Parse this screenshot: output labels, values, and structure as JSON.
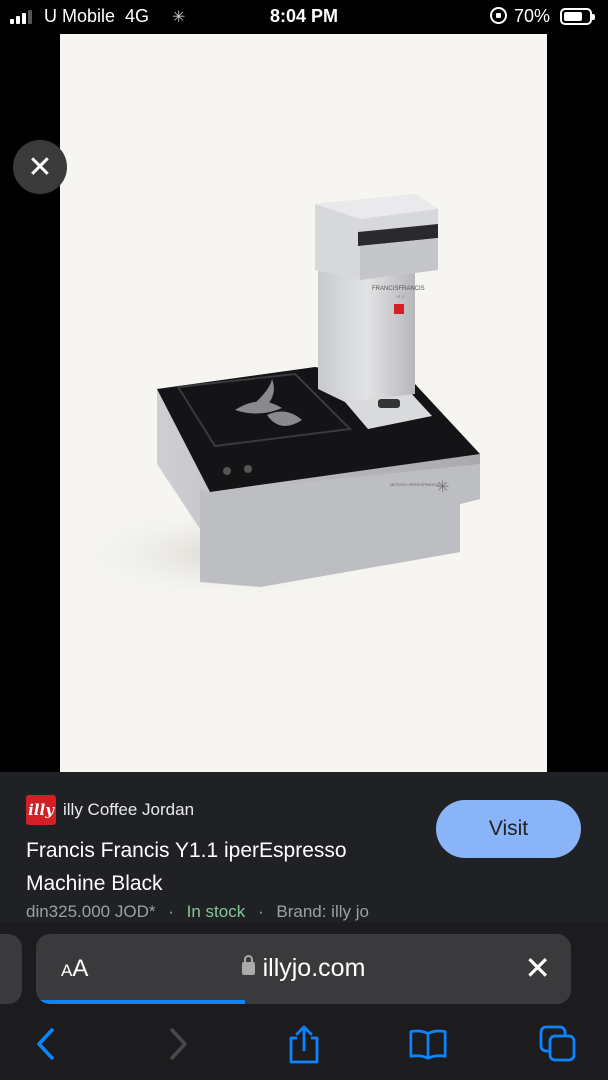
{
  "status_bar": {
    "carrier": "U Mobile",
    "network": "4G",
    "time": "8:04 PM",
    "battery_percent": "70%",
    "battery_level": 0.7
  },
  "product": {
    "site_name": "illy Coffee Jordan",
    "logo_text": "illy",
    "title": "Francis Francis Y1.1 iperEspresso Machine Black",
    "price": "din325.000 JOD*",
    "separator": "·",
    "availability": "In stock",
    "brand": "Brand: illy jo",
    "visit_label": "Visit"
  },
  "image_text": {
    "machine_brand": "FRANCISFRANCIS",
    "machine_model": "Y1.1",
    "method": "METODO IPERESPRESSO"
  },
  "browser": {
    "aa_label_small": "A",
    "aa_label_large": "A",
    "url": "illyjo.com",
    "load_progress": 0.39
  },
  "icons": {
    "close": "close-icon",
    "back": "chevron-left-icon",
    "forward": "chevron-right-icon",
    "share": "share-icon",
    "bookmarks": "book-icon",
    "tabs": "tabs-icon"
  },
  "colors": {
    "visit_button": "#8ab4f8",
    "in_stock": "#81c995",
    "accent": "#0a84ff",
    "illy_red": "#d31f26"
  }
}
